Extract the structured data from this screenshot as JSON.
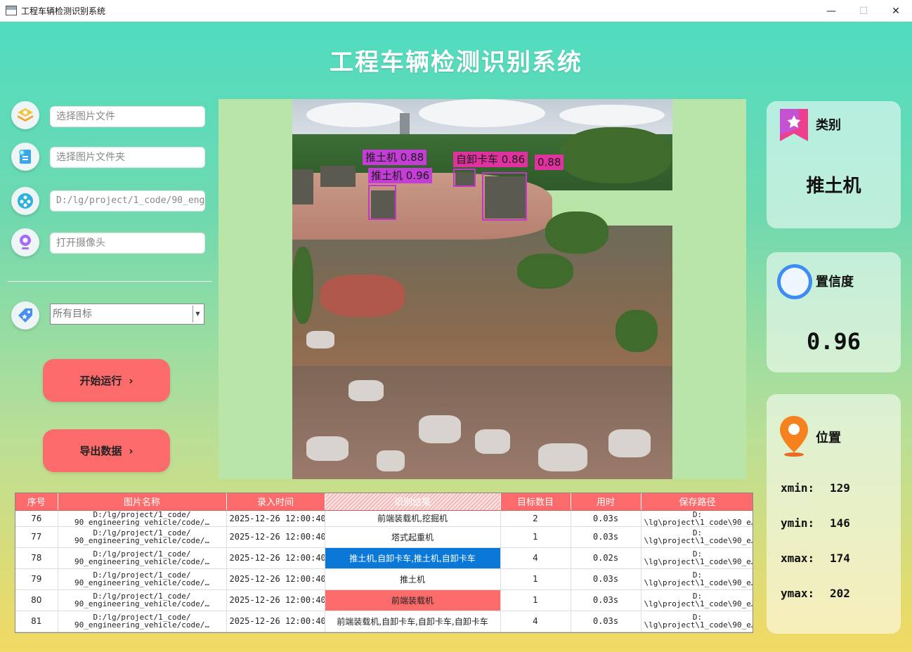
{
  "window": {
    "title": "工程车辆检测识别系统",
    "controls": {
      "minimize": "—",
      "maximize": "☐",
      "close": "✕"
    }
  },
  "app_title": "工程车辆检测识别系统",
  "left": {
    "select_image_placeholder": "选择图片文件",
    "select_folder_placeholder": "选择图片文件夹",
    "video_path_value": "D:/lg/project/1_code/90_eng",
    "camera_placeholder": "打开摄像头",
    "target_select_value": "所有目标",
    "run_button": "开始运行",
    "export_button": "导出数据",
    "chevron": "›"
  },
  "detections": [
    {
      "label": "推土机 0.88",
      "color": "purple"
    },
    {
      "label": "推土机 0.96",
      "color": "purple"
    },
    {
      "label": "自卸卡车 0.86",
      "color": "pink"
    },
    {
      "label": "0.88",
      "color": "pink"
    }
  ],
  "info": {
    "category_heading": "类别",
    "category_value": "推土机",
    "confidence_heading": "置信度",
    "confidence_value": "0.96",
    "position_heading": "位置",
    "xmin_label": "xmin:",
    "xmin": "129",
    "ymin_label": "ymin:",
    "ymin": "146",
    "xmax_label": "xmax:",
    "xmax": "174",
    "ymax_label": "ymax:",
    "ymax": "202"
  },
  "table": {
    "headers": [
      "序号",
      "图片名称",
      "录入时间",
      "识别结果",
      "目标数目",
      "用时",
      "保存路径"
    ],
    "rows": [
      {
        "idx": "76",
        "name": "D:/lg/project/1_code/ 90_engineering_vehicle/code/…",
        "time": "2025-12-26 12:00:40",
        "result": "前端装载机,挖掘机",
        "count": "2",
        "dur": "0.03s",
        "path": "D: \\lg\\project\\1_code\\90_e…"
      },
      {
        "idx": "77",
        "name": "D:/lg/project/1_code/ 90_engineering_vehicle/code/…",
        "time": "2025-12-26 12:00:40",
        "result": "塔式起重机",
        "count": "1",
        "dur": "0.03s",
        "path": "D: \\lg\\project\\1_code\\90_e…"
      },
      {
        "idx": "78",
        "name": "D:/lg/project/1_code/ 90_engineering_vehicle/code/…",
        "time": "2025-12-26 12:00:40",
        "result": "推土机,自卸卡车,推土机,自卸卡车",
        "count": "4",
        "dur": "0.02s",
        "path": "D: \\lg\\project\\1_code\\90_e…"
      },
      {
        "idx": "79",
        "name": "D:/lg/project/1_code/ 90_engineering_vehicle/code/…",
        "time": "2025-12-26 12:00:40",
        "result": "推土机",
        "count": "1",
        "dur": "0.03s",
        "path": "D: \\lg\\project\\1_code\\90_e…"
      },
      {
        "idx": "80",
        "name": "D:/lg/project/1_code/ 90_engineering_vehicle/code/…",
        "time": "2025-12-26 12:00:40",
        "result": "前端装载机",
        "count": "1",
        "dur": "0.03s",
        "path": "D: \\lg\\project\\1_code\\90_e…"
      },
      {
        "idx": "81",
        "name": "D:/lg/project/1_code/ 90_engineering_vehicle/code/…",
        "time": "2025-12-26 12:00:40",
        "result": "前端装载机,自卸卡车,自卸卡车,自卸卡车",
        "count": "4",
        "dur": "0.03s",
        "path": "D: \\lg\\project\\1_code\\90_e…"
      }
    ]
  }
}
